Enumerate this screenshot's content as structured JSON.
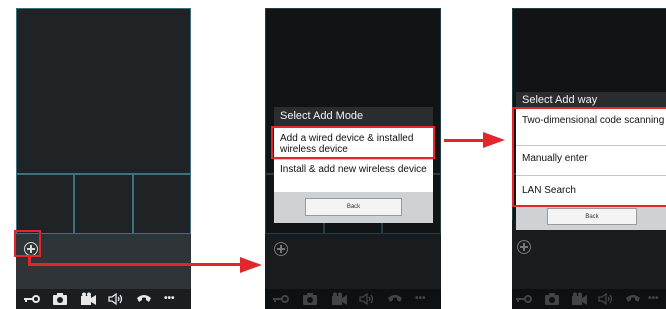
{
  "phone1": {
    "bottom_bar_icons": [
      "key-icon",
      "camera-icon",
      "video-icon",
      "speaker-icon",
      "phone-icon",
      "more-icon"
    ],
    "more_label": "•••"
  },
  "phone2": {
    "dialog": {
      "title": "Select Add Mode",
      "options": [
        "Add a wired device & installed wireless device",
        "Install & add new wireless device"
      ],
      "back_label": "Back"
    }
  },
  "phone3": {
    "dialog": {
      "title": "Select Add way",
      "options": [
        "Two-dimensional code scanning",
        "Manually enter",
        "LAN Search"
      ],
      "back_label": "Back"
    }
  },
  "colors": {
    "highlight": "#e3262b",
    "grid_border": "#3f6f7d",
    "screen_bg": "#1f2325"
  }
}
